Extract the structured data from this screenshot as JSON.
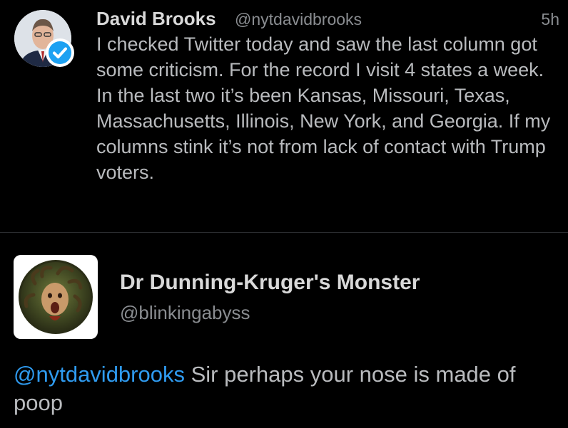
{
  "tweet": {
    "author_name": "David Brooks",
    "author_handle": "@nytdavidbrooks",
    "timestamp": "5h",
    "text": "I checked Twitter today and saw the last column got some criticism. For the record I visit 4 states a week. In the last two it’s been Kansas, Missouri, Texas, Massachusetts, Illinois, New York, and Georgia. If my columns stink it’s not from lack of contact with Trump voters.",
    "avatar_icon": "person-avatar",
    "verified_icon": "verified-badge-icon"
  },
  "reply": {
    "author_name": "Dr Dunning-Kruger's Monster",
    "author_handle": "@blinkingabyss",
    "avatar_icon": "medusa-painting-avatar",
    "mention": "@nytdavidbrooks",
    "text": " Sir perhaps your nose is made of poop"
  },
  "colors": {
    "background": "#000000",
    "name": "#d9d9d9",
    "body_text": "#b9bbbe",
    "meta": "#8a8d91",
    "link": "#2f9bf0"
  }
}
